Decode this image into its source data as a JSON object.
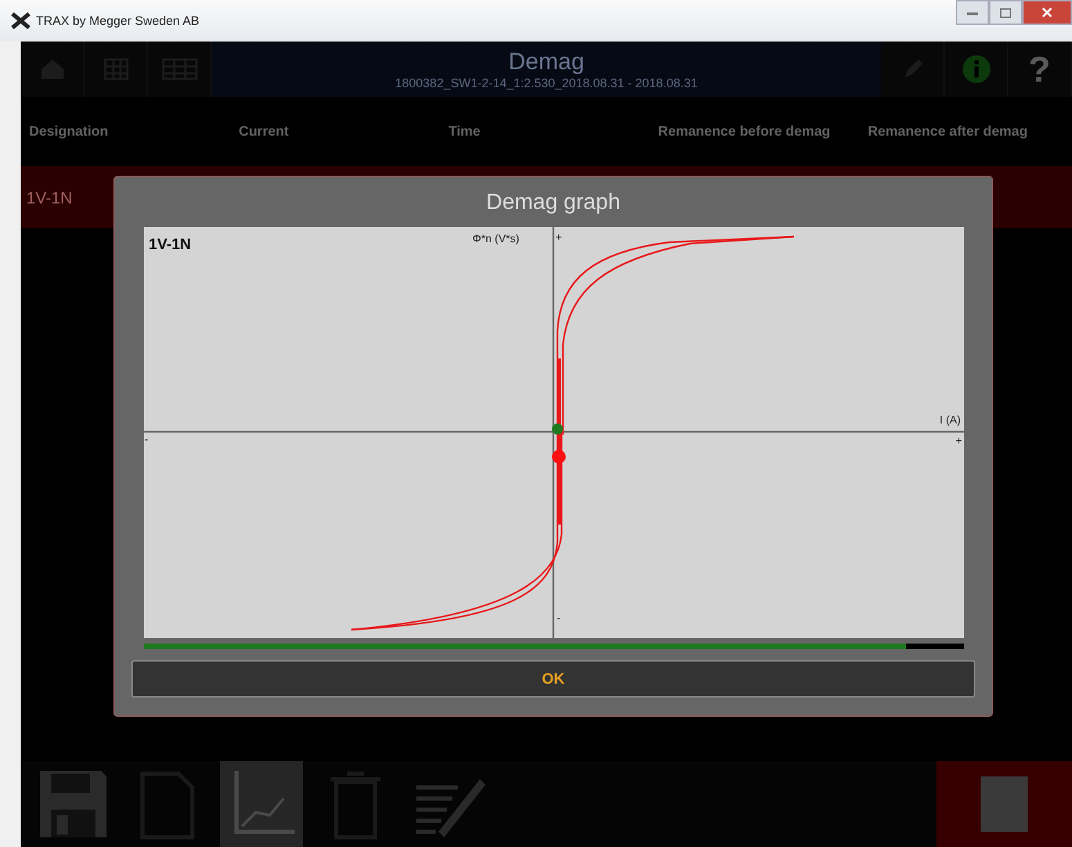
{
  "window": {
    "title": "TRAX by Megger Sweden AB"
  },
  "header": {
    "title": "Demag",
    "subtitle": "1800382_SW1-2-14_1:2.530_2018.08.31 - 2018.08.31",
    "help": "?"
  },
  "table": {
    "columns": [
      "Designation",
      "Current",
      "Time",
      "Remanence before demag",
      "Remanence after demag"
    ],
    "rows": [
      {
        "designation": "1V-1N",
        "selected": true
      }
    ]
  },
  "dialog": {
    "title": "Demag graph",
    "graph_label": "1V-1N",
    "y_axis": {
      "label": "Φ*n (V*s)",
      "max_mark": "+",
      "min_mark": "-"
    },
    "x_axis": {
      "label": "I (A)",
      "max_mark": "+",
      "min_mark": "-"
    },
    "progress": {
      "level": 0.93
    },
    "ok": "OK"
  },
  "toolbar": {
    "items": [
      {
        "kind": "save",
        "selected": false
      },
      {
        "kind": "document",
        "selected": false
      },
      {
        "kind": "graph",
        "selected": true
      },
      {
        "kind": "trash",
        "selected": false
      },
      {
        "kind": "edit",
        "selected": false
      }
    ]
  }
}
